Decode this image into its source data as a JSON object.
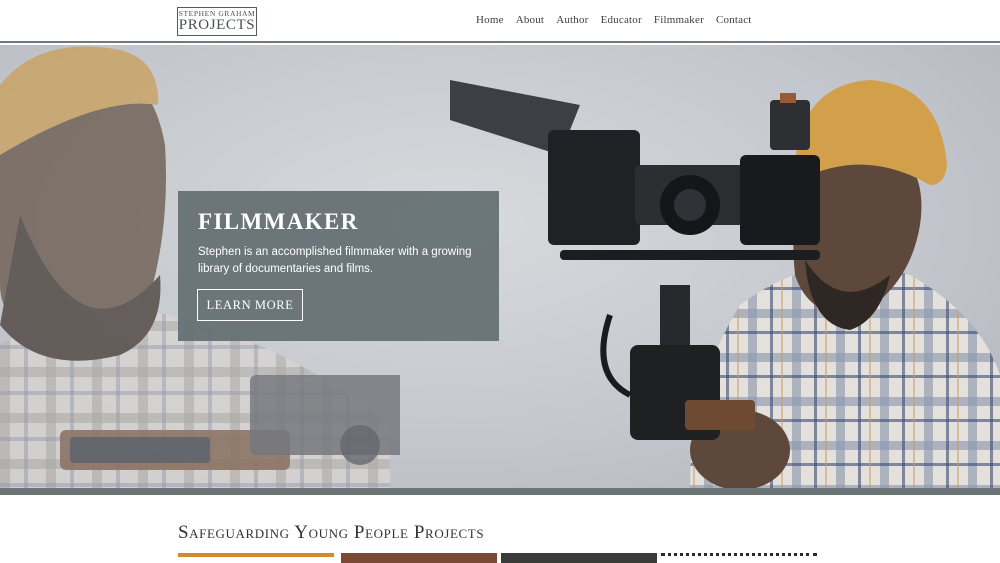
{
  "logo": {
    "top": "STEPHEN GRAHAM",
    "bottom": "PROJECTS"
  },
  "nav": [
    {
      "label": "Home"
    },
    {
      "label": "About"
    },
    {
      "label": "Author"
    },
    {
      "label": "Educator"
    },
    {
      "label": "Filmmaker"
    },
    {
      "label": "Contact"
    }
  ],
  "hero": {
    "title": "Filmmaker",
    "description": "Stephen is an accomplished filmmaker with a growing library of documentaries and films.",
    "button": "Learn more"
  },
  "section": {
    "title": "Safeguarding Young People Projects"
  },
  "colors": {
    "accent": "#d58a2e",
    "card": "#646f72",
    "bar": "#6b7476"
  }
}
